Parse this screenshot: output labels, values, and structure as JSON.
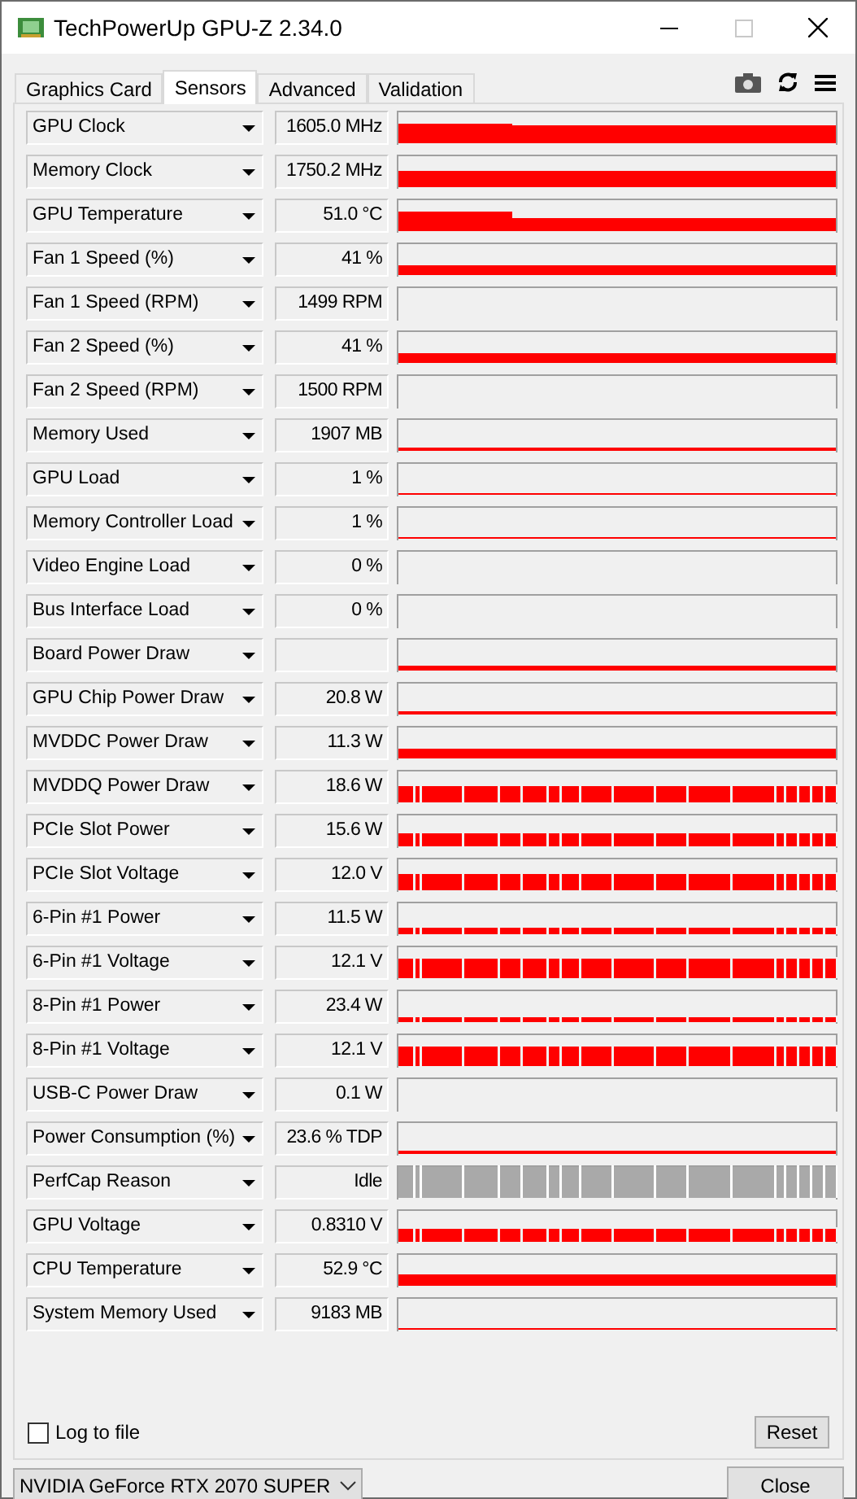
{
  "window": {
    "title": "TechPowerUp GPU-Z 2.34.0"
  },
  "tabs": [
    {
      "label": "Graphics Card",
      "selected": false
    },
    {
      "label": "Sensors",
      "selected": true
    },
    {
      "label": "Advanced",
      "selected": false
    },
    {
      "label": "Validation",
      "selected": false
    }
  ],
  "sensors": [
    {
      "name": "GPU Clock",
      "value": "1605.0 MHz",
      "color": "#ff0000"
    },
    {
      "name": "Memory Clock",
      "value": "1750.2 MHz",
      "color": "#ff0000"
    },
    {
      "name": "GPU Temperature",
      "value": "51.0 °C",
      "color": "#ff0000"
    },
    {
      "name": "Fan 1 Speed (%)",
      "value": "41 %",
      "color": "#ff0000"
    },
    {
      "name": "Fan 1 Speed (RPM)",
      "value": "1499 RPM"
    },
    {
      "name": "Fan 2 Speed (%)",
      "value": "41 %",
      "color": "#ff0000"
    },
    {
      "name": "Fan 2 Speed (RPM)",
      "value": "1500 RPM"
    },
    {
      "name": "Memory Used",
      "value": "1907 MB",
      "color": "#ff0000"
    },
    {
      "name": "GPU Load",
      "value": "1 %",
      "color": "#ff0000"
    },
    {
      "name": "Memory Controller Load",
      "value": "1 %",
      "color": "#ff0000"
    },
    {
      "name": "Video Engine Load",
      "value": "0 %"
    },
    {
      "name": "Bus Interface Load",
      "value": "0 %"
    },
    {
      "name": "Board Power Draw",
      "color": "#ff0000"
    },
    {
      "name": "GPU Chip Power Draw",
      "value": "20.8 W",
      "color": "#ff0000"
    },
    {
      "name": "MVDDC Power Draw",
      "value": "11.3 W",
      "color": "#ff0000"
    },
    {
      "name": "MVDDQ Power Draw",
      "value": "18.6 W",
      "color": "#ff0000"
    },
    {
      "name": "PCIe Slot Power",
      "value": "15.6 W",
      "color": "#ff0000"
    },
    {
      "name": "PCIe Slot Voltage",
      "value": "12.0 V",
      "color": "#ff0000"
    },
    {
      "name": "6-Pin #1 Power",
      "value": "11.5 W",
      "color": "#ff0000"
    },
    {
      "name": "6-Pin #1 Voltage",
      "value": "12.1 V",
      "color": "#ff0000"
    },
    {
      "name": "8-Pin #1 Power",
      "value": "23.4 W",
      "color": "#ff0000"
    },
    {
      "name": "8-Pin #1 Voltage",
      "value": "12.1 V",
      "color": "#ff0000"
    },
    {
      "name": "USB-C Power Draw",
      "value": "0.1 W"
    },
    {
      "name": "Power Consumption (%)",
      "value": "23.6 % TDP",
      "color": "#ff0000"
    },
    {
      "name": "PerfCap Reason",
      "value": "Idle",
      "color": "#a9a9a9"
    },
    {
      "name": "GPU Voltage",
      "value": "0.8310 V",
      "color": "#ff0000"
    },
    {
      "name": "CPU Temperature",
      "value": "52.9 °C",
      "color": "#ff0000"
    },
    {
      "name": "System Memory Used",
      "value": "9183 MB",
      "color": "#ff0000"
    }
  ],
  "log_to_file": {
    "label": "Log to file",
    "checked": false
  },
  "reset_button": "Reset",
  "gpu_select": "NVIDIA GeForce RTX 2070 SUPER",
  "close_button": "Close"
}
